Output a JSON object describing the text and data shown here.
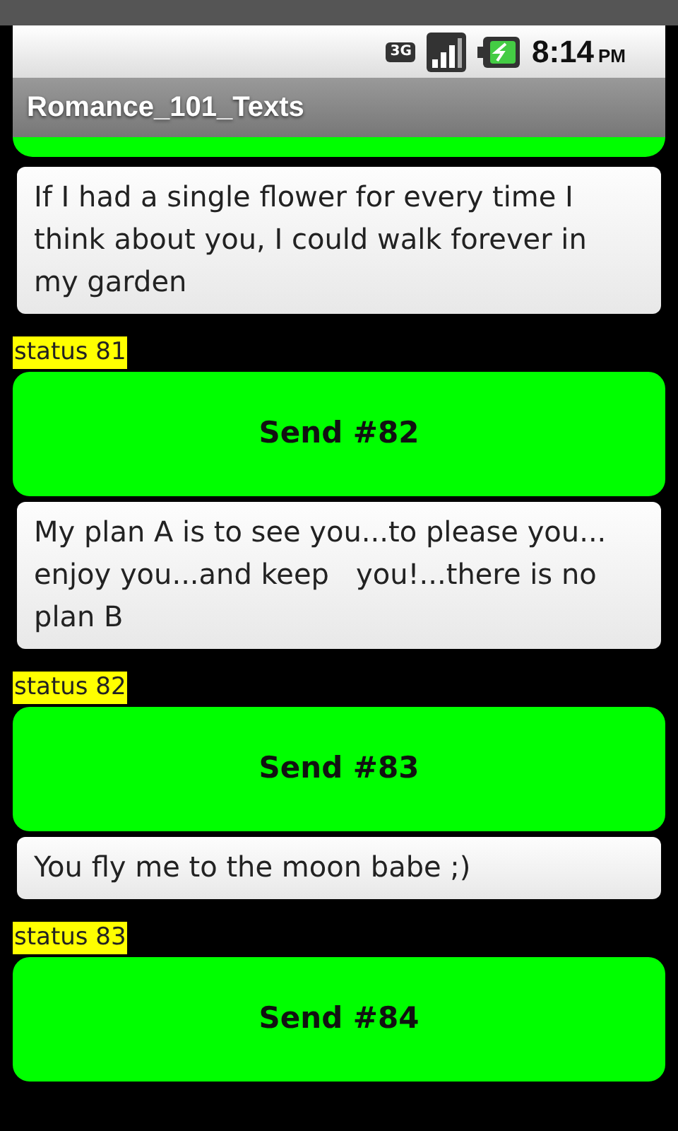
{
  "status_bar": {
    "network": "3G",
    "time": "8:14",
    "ampm": "PM"
  },
  "window": {
    "title": "Romance_101_Texts"
  },
  "items": [
    {
      "kind": "button"
    },
    {
      "kind": "message",
      "text": "If I had a single flower for every time I think about you, I could walk forever in my garden"
    },
    {
      "kind": "status",
      "text": "status 81"
    },
    {
      "kind": "button",
      "label": "Send #82"
    },
    {
      "kind": "message",
      "text": "My plan A is to see you...to please you... enjoy you...and keep   you!...there is no plan B"
    },
    {
      "kind": "status",
      "text": "status 82"
    },
    {
      "kind": "button",
      "label": "Send #83"
    },
    {
      "kind": "message",
      "text": "You fly me to the moon babe ;)"
    },
    {
      "kind": "status",
      "text": "status 83"
    },
    {
      "kind": "button",
      "label": "Send #84"
    }
  ]
}
